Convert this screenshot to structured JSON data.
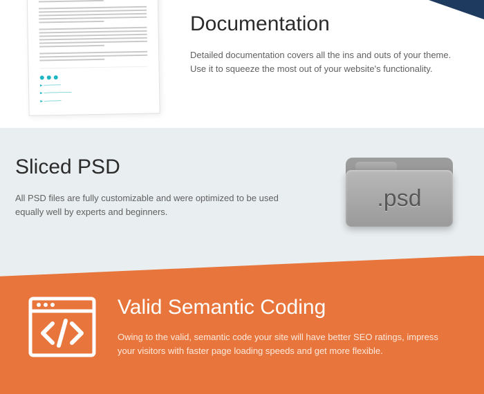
{
  "documentation": {
    "title": "Documentation",
    "body": "Detailed documentation covers all the ins and outs of your theme. Use it to squeeze the most out of your website's functionality."
  },
  "sliced_psd": {
    "title": "Sliced PSD",
    "body": "All PSD files are fully customizable and were optimized to be used equally well by experts and beginners.",
    "icon_label": ".psd"
  },
  "valid_coding": {
    "title": "Valid Semantic Coding",
    "body": "Owing to the valid, semantic code your site will have better SEO ratings, impress your visitors with faster page loading speeds and get more flexible."
  },
  "colors": {
    "accent_orange": "#e8753b",
    "accent_teal": "#1fb6c4",
    "dark_corner": "#1f3a5f"
  }
}
